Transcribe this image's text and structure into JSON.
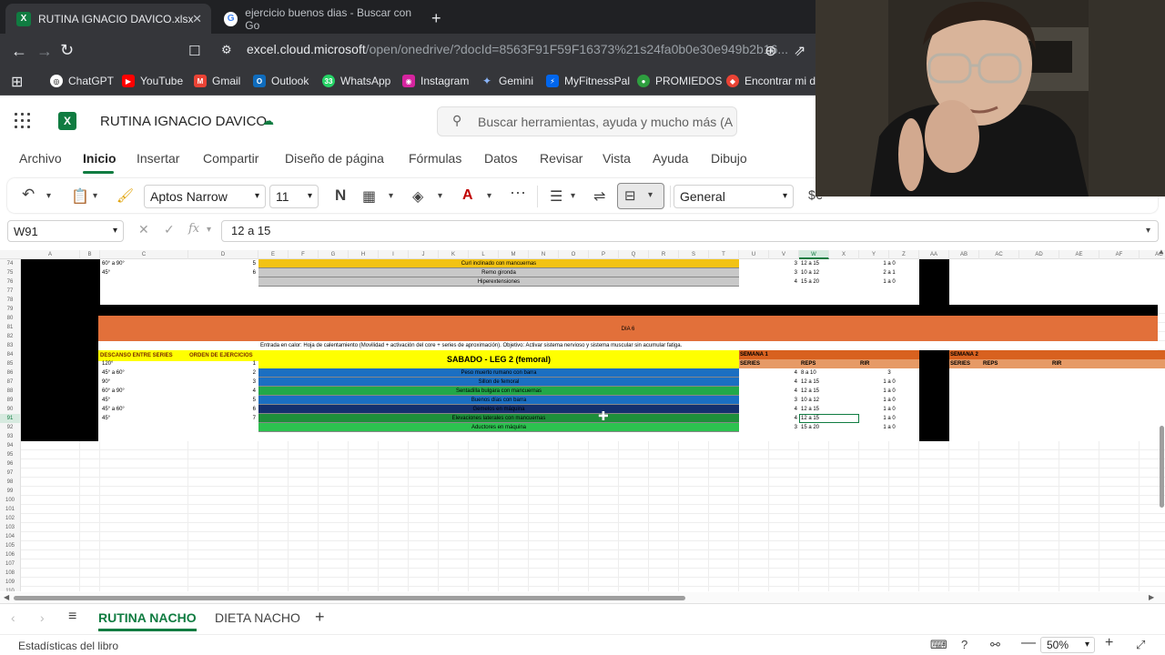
{
  "browser": {
    "tabs": [
      {
        "title": "RUTINA IGNACIO DAVICO.xlsx",
        "active": true
      },
      {
        "title": "ejercicio buenos dias - Buscar con Go",
        "active": false
      }
    ],
    "url_host": "excel.cloud.microsoft",
    "url_path": "/open/onedrive/?docId=8563F91F59F16373%21s24fa0b0e30e949b2b16...",
    "bookmarks": [
      "ChatGPT",
      "YouTube",
      "Gmail",
      "Outlook",
      "WhatsApp",
      "Instagram",
      "Gemini",
      "MyFitnessPal",
      "PROMIEDOS",
      "Encontrar mi dis"
    ]
  },
  "excel": {
    "doc_title": "RUTINA IGNACIO DAVICO",
    "search_placeholder": "Buscar herramientas, ayuda y mucho más (A",
    "menu": [
      "Archivo",
      "Inicio",
      "Insertar",
      "Compartir",
      "Diseño de página",
      "Fórmulas",
      "Datos",
      "Revisar",
      "Vista",
      "Ayuda",
      "Dibujo"
    ],
    "font_name": "Aptos Narrow",
    "font_size": "11",
    "number_format": "General",
    "name_box": "W91",
    "formula": "12 a 15",
    "sheet_tabs": [
      "RUTINA NACHO",
      "DIETA NACHO"
    ],
    "status_text": "Estadísticas del libro",
    "zoom": "50%"
  },
  "sheet": {
    "columns": [
      "A",
      "B",
      "C",
      "D",
      "E",
      "F",
      "G",
      "H",
      "I",
      "J",
      "K",
      "L",
      "M",
      "N",
      "O",
      "P",
      "Q",
      "R",
      "S",
      "T",
      "U",
      "V",
      "W",
      "X",
      "Y",
      "Z",
      "AA",
      "AB",
      "AC",
      "AD",
      "AE",
      "AF",
      "AG",
      "AH"
    ],
    "rows": [
      "74",
      "75",
      "76",
      "77",
      "78",
      "79",
      "80",
      "81",
      "82",
      "83",
      "84",
      "85",
      "86",
      "87",
      "88",
      "89",
      "90",
      "91",
      "92",
      "93",
      "94",
      "95",
      "96",
      "97",
      "98",
      "99",
      "100",
      "101",
      "102",
      "103",
      "104",
      "105",
      "106",
      "107",
      "108",
      "109",
      "110"
    ],
    "selected_col": "W",
    "selected_row": "91",
    "prev_block": [
      {
        "rest": "60° a 90°",
        "order": "5",
        "exercise": "Curl inclinado con mancuernas",
        "series": "3",
        "reps": "12 a 15",
        "rir": "1 a 0"
      },
      {
        "rest": "45°",
        "order": "6",
        "exercise": "Remo gironda",
        "series": "3",
        "reps": "10 a 12",
        "rir": "2 a 1"
      },
      {
        "rest": "",
        "order": "",
        "exercise": "Hiperextensiones",
        "series": "4",
        "reps": "15 a 20",
        "rir": "1 a 0"
      }
    ],
    "day_title": "DIA 6",
    "warmup": "Entrada en calor: Hoja de calentamiento (Movilidad + activación del core + series de aproximación). Objetivo: Activar sistema nervioso y sistema muscular sin acumular fatiga.",
    "hdr_rest": "DESCANSO ENTRE SERIES",
    "hdr_order": "ORDEN DE EJERCICIOS",
    "session_title": "SABADO - LEG 2 (femoral)",
    "week1": "SEMANA 1",
    "week2": "SEMANA 2",
    "col_series": "SERIES",
    "col_reps": "REPS",
    "col_rir": "RIR",
    "exercises": [
      {
        "rest": "120°",
        "order": "1",
        "name": "Peso muerto rumano con barra",
        "series": "4",
        "reps": "8 a 10",
        "rir": "3",
        "color": "#1b6fc2"
      },
      {
        "rest": "45° a 60°",
        "order": "2",
        "name": "Sillon de femoral",
        "series": "4",
        "reps": "12 a 15",
        "rir": "1 a 0",
        "color": "#1b6fc2"
      },
      {
        "rest": "90°",
        "order": "3",
        "name": "Sentadilla bulgara con mancuernas",
        "series": "4",
        "reps": "12 a 15",
        "rir": "1 a 0",
        "color": "#22a84a"
      },
      {
        "rest": "60° a 90°",
        "order": "4",
        "name": "Buenos días con barra",
        "series": "3",
        "reps": "10 a 12",
        "rir": "1 a 0",
        "color": "#1b6fc2"
      },
      {
        "rest": "45°",
        "order": "5",
        "name": "Gemelos en máquina",
        "series": "4",
        "reps": "12 a 15",
        "rir": "1 a 0",
        "color": "#14306e"
      },
      {
        "rest": "45° a 60°",
        "order": "6",
        "name": "Elevaciones laterales con mancuernas",
        "series": "4",
        "reps": "12 a 15",
        "rir": "1 a 0",
        "color": "#1e8f3a"
      },
      {
        "rest": "45°",
        "order": "7",
        "name": "Aductores en máquina",
        "series": "3",
        "reps": "15 a 20",
        "rir": "1 a 0",
        "color": "#2cc24f"
      }
    ]
  },
  "colors": {
    "excel_green": "#107c41",
    "day_orange": "#e2703a",
    "yellow": "#ffff00",
    "week_orange": "#e69a66"
  }
}
